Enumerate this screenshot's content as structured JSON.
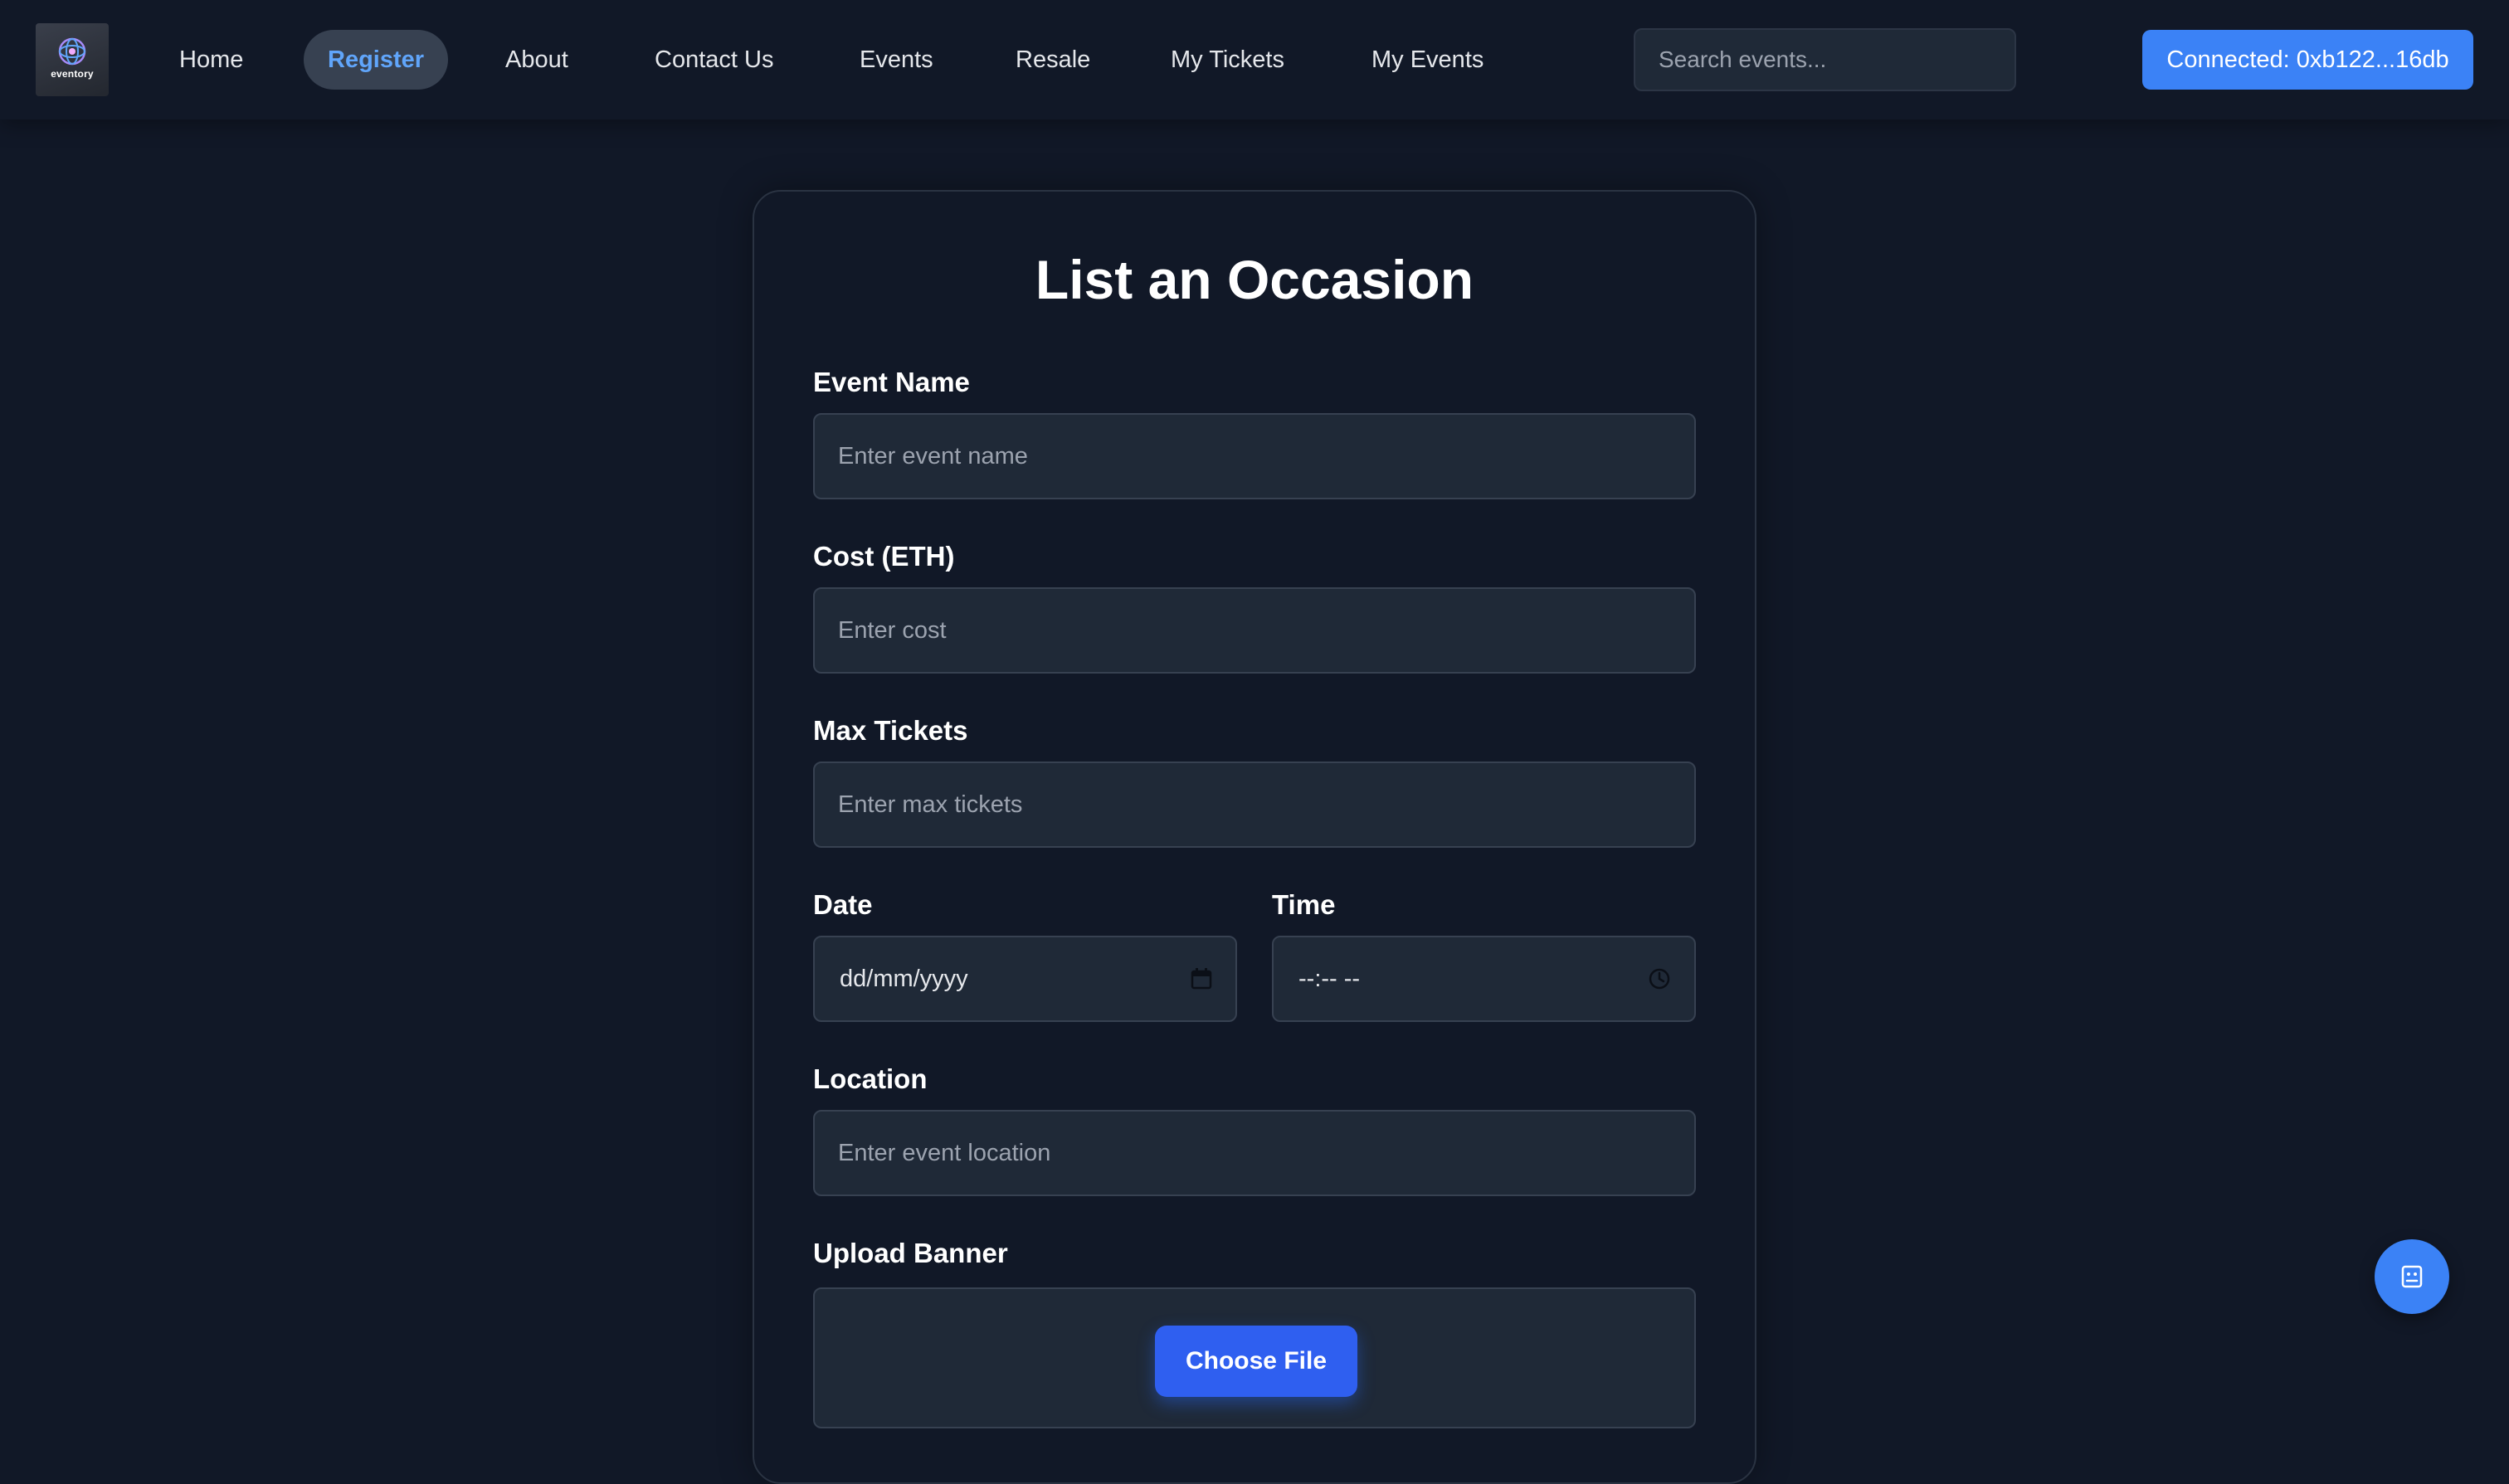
{
  "nav": {
    "logo_text": "eventory",
    "items": [
      {
        "label": "Home",
        "active": false
      },
      {
        "label": "Register",
        "active": true
      },
      {
        "label": "About",
        "active": false
      },
      {
        "label": "Contact Us",
        "active": false
      },
      {
        "label": "Events",
        "active": false
      },
      {
        "label": "Resale",
        "active": false
      },
      {
        "label": "My Tickets",
        "active": false
      },
      {
        "label": "My Events",
        "active": false
      }
    ],
    "search_placeholder": "Search events...",
    "connect_label": "Connected: 0xb122...16db"
  },
  "form": {
    "title": "List an Occasion",
    "event_name": {
      "label": "Event Name",
      "placeholder": "Enter event name"
    },
    "cost": {
      "label": "Cost (ETH)",
      "placeholder": "Enter cost"
    },
    "max_tickets": {
      "label": "Max Tickets",
      "placeholder": "Enter max tickets"
    },
    "date": {
      "label": "Date",
      "value": "dd/mm/yyyy",
      "icon": "calendar-icon"
    },
    "time": {
      "label": "Time",
      "value": "--:-- --",
      "icon": "clock-icon"
    },
    "location": {
      "label": "Location",
      "placeholder": "Enter event location"
    },
    "upload": {
      "label": "Upload Banner",
      "button_label": "Choose File"
    }
  },
  "fab": {
    "icon": "chat-icon"
  },
  "colors": {
    "background": "#111827",
    "surface": "#1f2937",
    "accent": "#3b82f6",
    "active_nav_text": "#60a5fa",
    "choose_button": "#2f5ff0"
  }
}
